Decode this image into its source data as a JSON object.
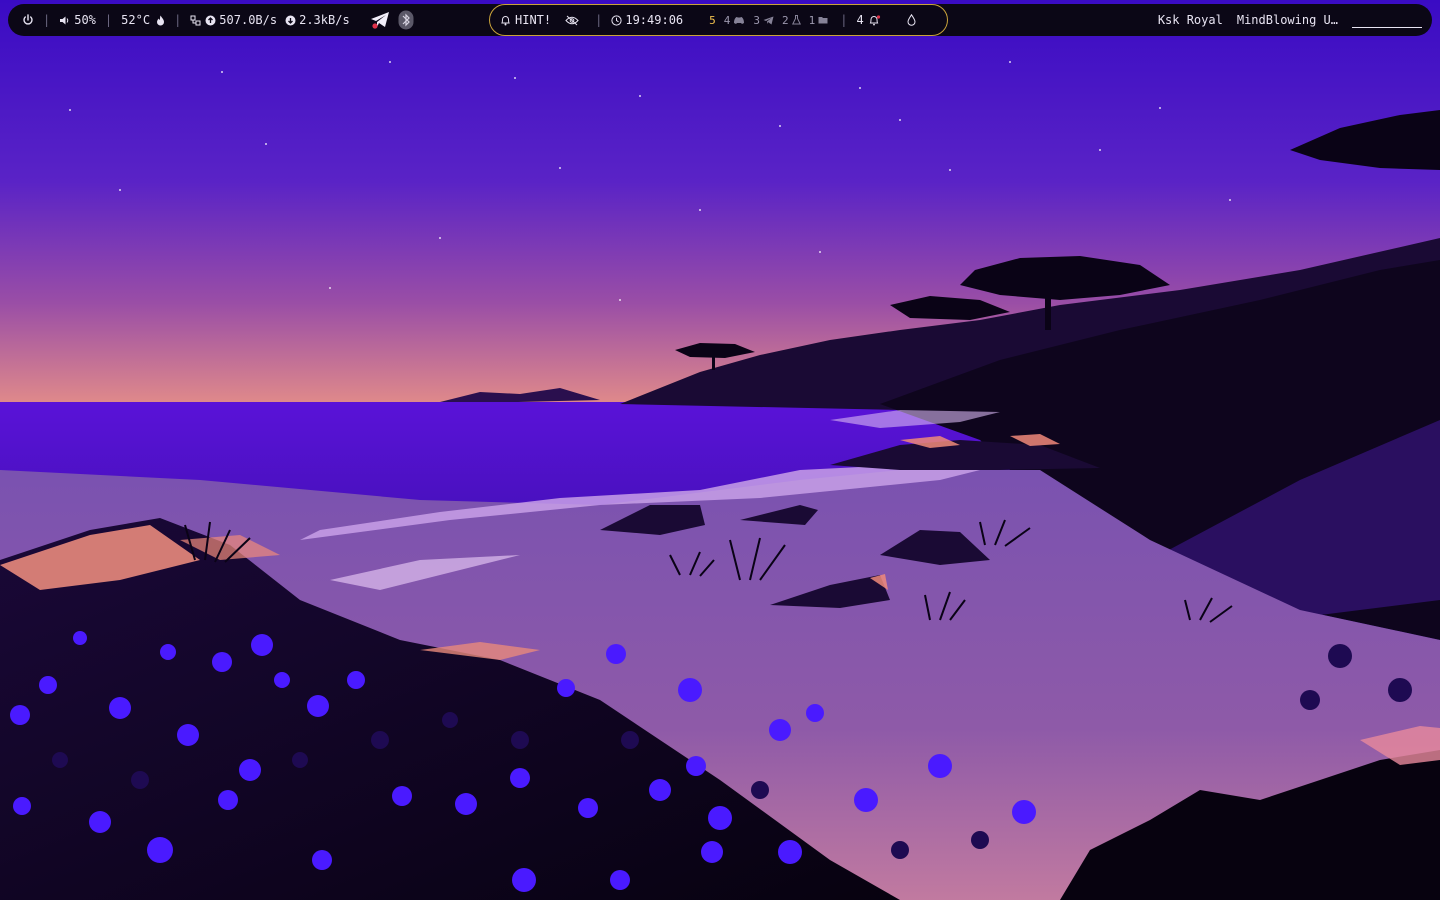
{
  "topbar": {
    "power_icon": "power-icon",
    "volume": {
      "icon": "speaker-icon",
      "value": "50%"
    },
    "temperature": {
      "value": "52°C",
      "icon": "flame-icon"
    },
    "network": {
      "icon": "network-icon",
      "upload": {
        "icon": "upload-arrow-icon",
        "value": "507.0B/s"
      },
      "download": {
        "icon": "download-arrow-icon",
        "value": "2.3kB/s"
      }
    },
    "tray": [
      "telegram-icon",
      "bluetooth-icon"
    ],
    "center": {
      "hint": {
        "icon": "bell-icon",
        "label": "HINT!"
      },
      "visibility_icon": "eye-off-icon",
      "clock": {
        "icon": "clock-icon",
        "value": "19:49:06"
      },
      "workspaces": [
        {
          "number": "5",
          "icon": "",
          "active": true
        },
        {
          "number": "4",
          "icon": "discord-icon",
          "active": false
        },
        {
          "number": "3",
          "icon": "telegram-icon",
          "active": false
        },
        {
          "number": "2",
          "icon": "flask-icon",
          "active": false
        },
        {
          "number": "1",
          "icon": "folder-icon",
          "active": false
        }
      ],
      "notifications": {
        "count": "4",
        "icon": "bell-dot-icon"
      },
      "droplet_icon": "droplet-icon"
    },
    "right": {
      "artist": "Ksk Royal",
      "song": "MindBlowing U…"
    }
  },
  "colors": {
    "bar_bg": "#0b0716",
    "accent_border": "#c9a33a",
    "active_workspace": "#f2c14e",
    "text": "#e8e4f2"
  }
}
